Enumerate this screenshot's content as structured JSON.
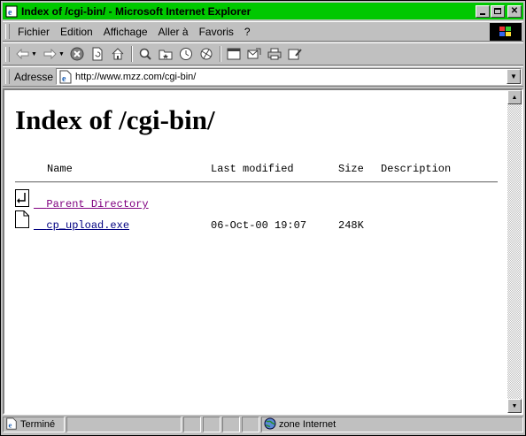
{
  "window": {
    "title": "Index of /cgi-bin/ - Microsoft Internet Explorer"
  },
  "menu": [
    "Fichier",
    "Edition",
    "Affichage",
    "Aller à",
    "Favoris",
    "?"
  ],
  "address": {
    "label": "Adresse",
    "url": "http://www.mzz.com/cgi-bin/"
  },
  "page": {
    "heading": "Index of /cgi-bin/",
    "columns": {
      "name": "Name",
      "modified": "Last modified",
      "size": "Size",
      "description": "Description"
    },
    "entries": [
      {
        "name": "Parent Directory",
        "modified": "",
        "size": "",
        "icon": "back-folder-icon"
      },
      {
        "name": "cp_upload.exe",
        "modified": "06-Oct-00 19:07",
        "size": "248K",
        "icon": "file-icon"
      }
    ]
  },
  "status": {
    "left": "Terminé",
    "zone": "zone Internet"
  },
  "colors": {
    "titlebar": "#00c800",
    "visited_link": "#800080",
    "link": "#000080"
  }
}
